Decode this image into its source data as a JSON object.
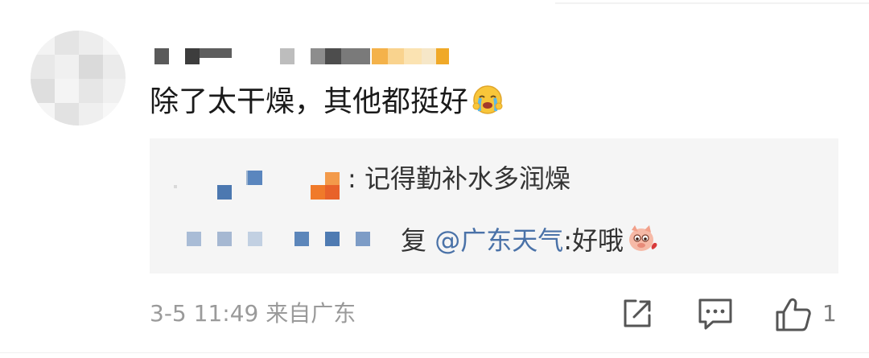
{
  "comment": {
    "text": "除了太干燥，其他都挺好",
    "emoji": "crying-face-emoji"
  },
  "replies": [
    {
      "text": ": 记得勤补水多润燥"
    },
    {
      "prefix": "复",
      "mention": "@广东天气",
      "text": ":好哦",
      "emoji": "pig-face-emoji"
    }
  ],
  "footer": {
    "timestamp": "3-5 11:49 来自广东",
    "share_icon": "share-icon",
    "comment_icon": "comment-icon",
    "like_icon": "thumbs-up-icon",
    "like_count": "1"
  },
  "colors": {
    "mention": "#4a72a8",
    "reply_bg": "#f5f5f5",
    "meta_text": "#9a9a9a"
  }
}
